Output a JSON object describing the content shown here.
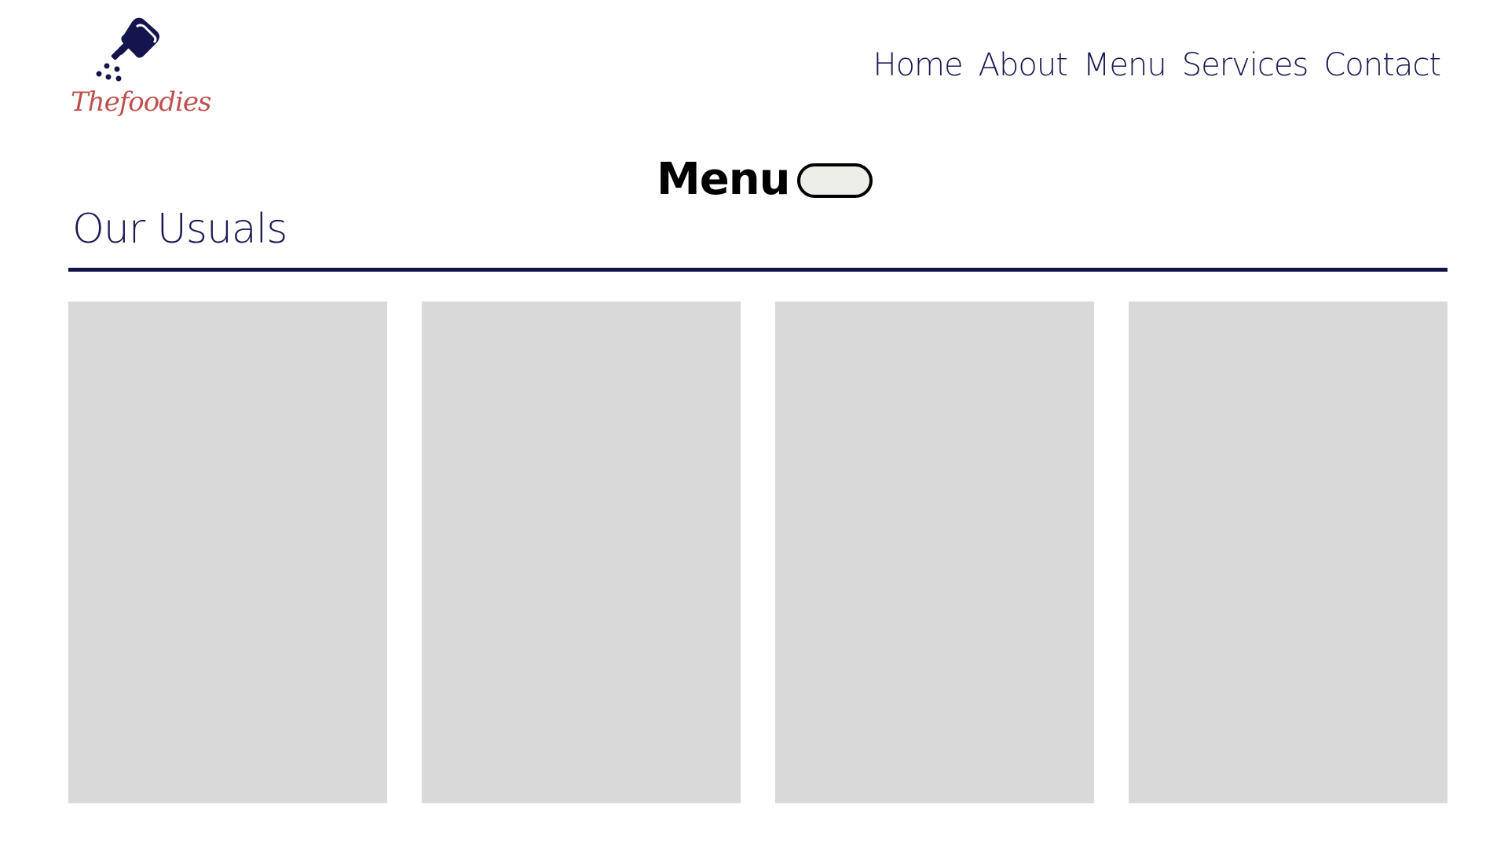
{
  "brand": {
    "name": "Thefoodies",
    "icon": "salt-shaker-icon",
    "icon_color": "#14144e",
    "text_color": "#c0504d"
  },
  "nav": {
    "items": [
      "Home",
      "About",
      "Menu",
      "Services",
      "Contact"
    ],
    "color": "#1b1b55"
  },
  "page": {
    "title": "Menu",
    "toggle_icon": "toggle-switch"
  },
  "section": {
    "title": "Our Usuals",
    "divider_color": "#12124a"
  },
  "cards": {
    "count": 4,
    "placeholder_color": "#d9d9d9"
  }
}
